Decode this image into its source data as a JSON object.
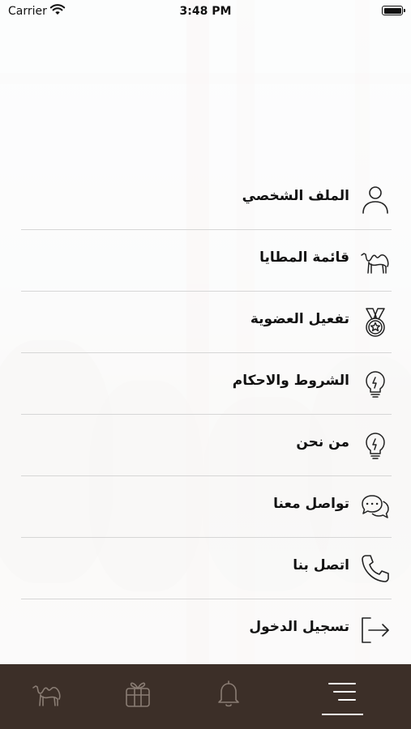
{
  "status_bar": {
    "carrier": "Carrier",
    "time": "3:48 PM"
  },
  "menu": {
    "items": [
      {
        "label": "الملف الشخصي",
        "icon": "user-icon"
      },
      {
        "label": "قائمة المطايا",
        "icon": "camel-icon"
      },
      {
        "label": "تفعيل العضوية",
        "icon": "medal-icon"
      },
      {
        "label": "الشروط والاحكام",
        "icon": "lightbulb-icon"
      },
      {
        "label": "من نحن",
        "icon": "lightbulb-icon"
      },
      {
        "label": "تواصل معنا",
        "icon": "chat-bubbles-icon"
      },
      {
        "label": "اتصل بنا",
        "icon": "phone-icon"
      },
      {
        "label": "تسجيل الدخول",
        "icon": "login-icon"
      }
    ]
  },
  "tab_bar": {
    "tabs": [
      {
        "icon": "camel-icon",
        "active": false
      },
      {
        "icon": "gift-icon",
        "active": false
      },
      {
        "icon": "bell-icon",
        "active": false
      },
      {
        "icon": "menu-icon",
        "active": true
      }
    ],
    "background": "#3c2f28",
    "inactive_icon_color": "#8a7d74",
    "active_icon_color": "#ffffff"
  }
}
